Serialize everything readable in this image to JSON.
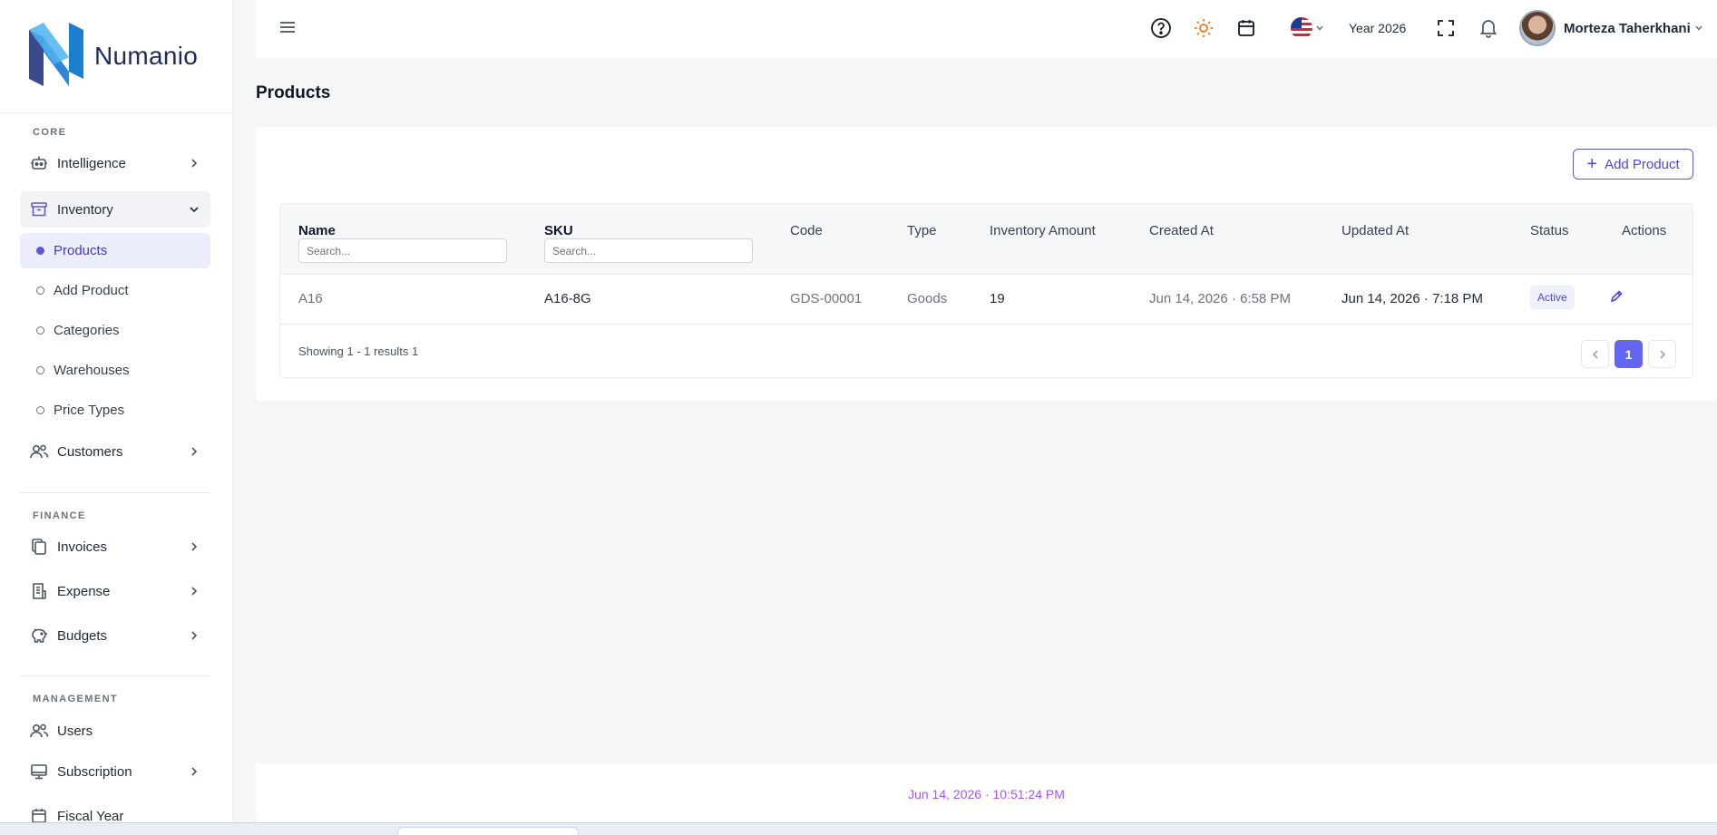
{
  "brand": {
    "name": "Numanio"
  },
  "sidebar": {
    "sections": {
      "core": "CORE",
      "finance": "FINANCE",
      "management": "MANAGEMENT"
    },
    "items": {
      "intelligence": "Intelligence",
      "inventory": "Inventory",
      "customers": "Customers",
      "invoices": "Invoices",
      "expense": "Expense",
      "budgets": "Budgets",
      "users": "Users",
      "subscription": "Subscription",
      "fiscal_year": "Fiscal Year"
    },
    "inventory_children": {
      "products": "Products",
      "add_product": "Add Product",
      "categories": "Categories",
      "warehouses": "Warehouses",
      "price_types": "Price Types"
    }
  },
  "header": {
    "year": "Year 2026",
    "user_name": "Morteza Taherkhani",
    "icons": [
      "menu-icon",
      "help-icon",
      "sun-icon",
      "calendar-icon",
      "us-flag-icon",
      "fullscreen-icon",
      "bell-icon"
    ]
  },
  "page": {
    "title": "Products",
    "add_button": "Add Product"
  },
  "table": {
    "columns": {
      "name": "Name",
      "sku": "SKU",
      "code": "Code",
      "type": "Type",
      "inventory_amount": "Inventory Amount",
      "created_at": "Created At",
      "updated_at": "Updated At",
      "status": "Status",
      "actions": "Actions"
    },
    "search_placeholder": "Search...",
    "rows": [
      {
        "name": "A16",
        "sku": "A16-8G",
        "code": "GDS-00001",
        "type": "Goods",
        "inventory_amount": "19",
        "created_at": "Jun 14, 2026 · 6:58 PM",
        "updated_at": "Jun 14, 2026 · 7:18 PM",
        "status": "Active"
      }
    ],
    "showing": "Showing 1 - 1 results 1",
    "current_page": "1"
  },
  "footer": {
    "timestamp": "Jun 14, 2026 · 10:51:24 PM"
  },
  "colors": {
    "accent": "#6366f1",
    "footer_text": "#a855f7",
    "sun": "#f97316",
    "background": "#f5f6f8"
  }
}
